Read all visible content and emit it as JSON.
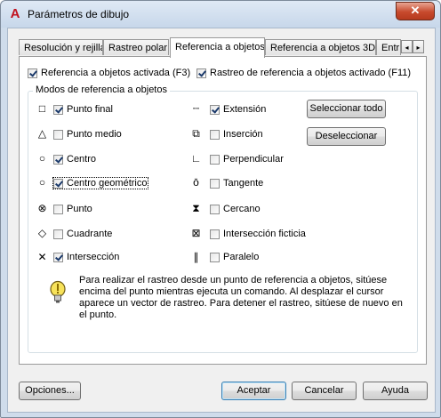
{
  "window": {
    "title": "Parámetros de dibujo",
    "close_glyph": "✕"
  },
  "tabs": [
    {
      "label": "Resolución y rejilla"
    },
    {
      "label": "Rastreo polar"
    },
    {
      "label": "Referencia a objetos"
    },
    {
      "label": "Referencia a objetos 3D"
    },
    {
      "label": "Entr"
    }
  ],
  "tab_scroll": {
    "left": "◂",
    "right": "▸"
  },
  "top_checks": {
    "osnap_on": {
      "label": "Referencia a objetos activada (F3)",
      "checked": true
    },
    "otrack_on": {
      "label": "Rastreo de referencia a objetos activado (F11)",
      "checked": true
    }
  },
  "group": {
    "title": "Modos de referencia a objetos",
    "left_modes": [
      {
        "label": "Punto final",
        "checked": true,
        "icon": "□"
      },
      {
        "label": "Punto medio",
        "checked": false,
        "icon": "△"
      },
      {
        "label": "Centro",
        "checked": true,
        "icon": "○"
      },
      {
        "label": "Centro geométrico",
        "checked": true,
        "icon": "○"
      },
      {
        "label": "Punto",
        "checked": false,
        "icon": "⊗"
      },
      {
        "label": "Cuadrante",
        "checked": false,
        "icon": "◇"
      },
      {
        "label": "Intersección",
        "checked": true,
        "icon": "✕"
      }
    ],
    "right_modes": [
      {
        "label": "Extensión",
        "checked": true,
        "icon": "┄"
      },
      {
        "label": "Inserción",
        "checked": false,
        "icon": "⧉"
      },
      {
        "label": "Perpendicular",
        "checked": false,
        "icon": "∟"
      },
      {
        "label": "Tangente",
        "checked": false,
        "icon": "ō"
      },
      {
        "label": "Cercano",
        "checked": false,
        "icon": "⧗"
      },
      {
        "label": "Intersección ficticia",
        "checked": false,
        "icon": "⊠"
      },
      {
        "label": "Paralelo",
        "checked": false,
        "icon": "∥"
      }
    ],
    "select_all": "Seleccionar todo",
    "deselect_all": "Deseleccionar",
    "info": "Para realizar el rastreo desde un punto de referencia a objetos, sitúese encima del punto mientras ejecuta un comando. Al desplazar el cursor aparece un vector de rastreo. Para detener el rastreo, sitúese de nuevo en el punto."
  },
  "footer": {
    "options": "Opciones...",
    "ok": "Aceptar",
    "cancel": "Cancelar",
    "help": "Ayuda"
  }
}
